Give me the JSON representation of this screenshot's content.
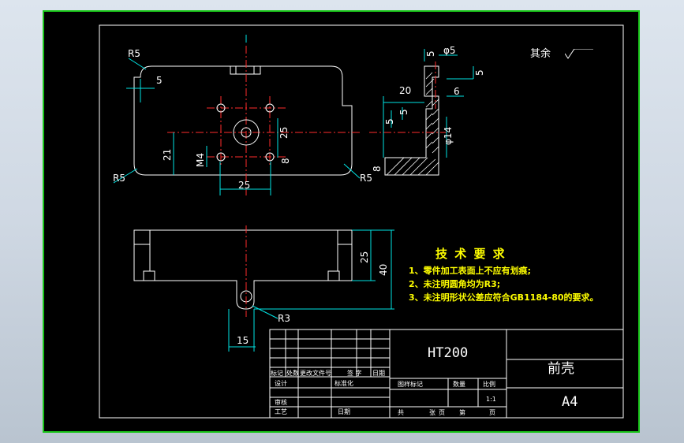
{
  "drawing": {
    "title": "前壳",
    "material": "HT200",
    "paper_size": "A4",
    "scale": "1:1",
    "surface_note": "其余",
    "roughness_symbol": "roughness-icon"
  },
  "dimensions": {
    "top_view": [
      "R5",
      "5",
      "25",
      "21",
      "M4",
      "8",
      "25",
      "R5",
      "R5"
    ],
    "side_view": [
      "5",
      "φ5",
      "5",
      "20",
      "6",
      "5",
      "5",
      "φ14",
      "8"
    ],
    "front_view": [
      "25",
      "40",
      "R3",
      "15"
    ]
  },
  "tech_requirements": {
    "heading": "技 术 要 求",
    "items": [
      "1、零件加工表面上不应有划痕;",
      "2、未注明圆角均为R3;",
      "3、未注明形状公差应符合GB1184-80的要求。"
    ]
  },
  "title_block": {
    "row_labels": [
      "标记",
      "处数",
      "更改文件号",
      "签 字",
      "日期"
    ],
    "design": "设计",
    "standardize": "标准化",
    "review": "审核",
    "process": "工艺",
    "date": "日期",
    "stage_mark": "图样标记",
    "weight": "数量",
    "scale_label": "比例",
    "total": "共",
    "sheets": "张",
    "page1": "页",
    "page2": "第",
    "page3": "页"
  },
  "colors": {
    "outline": "#ffffff",
    "frame": "#18c418",
    "center_line": "#ff2b2b",
    "dimension": "#00e5e5",
    "text_highlight": "#ffff00"
  }
}
